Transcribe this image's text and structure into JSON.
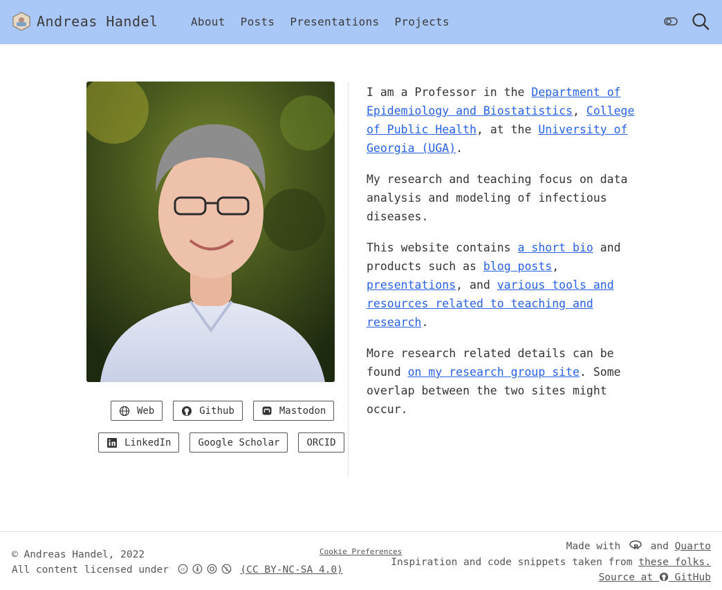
{
  "navbar": {
    "brand_title": "Andreas Handel",
    "links": [
      {
        "label": "About"
      },
      {
        "label": "Posts"
      },
      {
        "label": "Presentations"
      },
      {
        "label": "Projects"
      }
    ],
    "background_color": "#a9c8f7",
    "toggle_icon": "toggle-icon",
    "search_icon": "search-icon"
  },
  "profile": {
    "links_row1": [
      {
        "label": "Web",
        "icon": "globe-icon"
      },
      {
        "label": "Github",
        "icon": "github-icon"
      },
      {
        "label": "Mastodon",
        "icon": "mastodon-icon"
      }
    ],
    "links_row2": [
      {
        "label": "LinkedIn",
        "icon": "linkedin-icon"
      },
      {
        "label": "Google Scholar"
      },
      {
        "label": "ORCID"
      }
    ]
  },
  "bio": {
    "p1_pre": "I am a Professor in the ",
    "p1_link1": "Department of Epidemiology and Biostatistics",
    "p1_sep1": ", ",
    "p1_link2": "College of Public Health",
    "p1_sep2": ", at the ",
    "p1_link3": "University of Georgia (UGA)",
    "p1_end": ".",
    "p2": "My research and teaching focus on data analysis and modeling of infectious diseases.",
    "p3_pre": "This website contains ",
    "p3_link1": "a short bio",
    "p3_mid1": " and products such as ",
    "p3_link2": "blog posts",
    "p3_mid2": ", ",
    "p3_link3": "presentations",
    "p3_mid3": ", and ",
    "p3_link4": "various tools and resources related to teaching and research",
    "p3_end": ".",
    "p4_pre": "More research related details can be found ",
    "p4_link": "on my research group site",
    "p4_end": ". Some overlap between the two sites might occur.",
    "link_color": "#2761e3"
  },
  "footer": {
    "copyright": "© Andreas Handel, 2022",
    "license_pre": "All content licensed under",
    "license_link": "(CC BY-NC-SA 4.0)",
    "cookie": "Cookie Preferences",
    "made_with": "Made with",
    "and": "and",
    "quarto": "Quarto",
    "inspiration": "Inspiration and code snippets taken from",
    "these_folks": "these folks.",
    "source": "Source at",
    "github": "GitHub"
  }
}
